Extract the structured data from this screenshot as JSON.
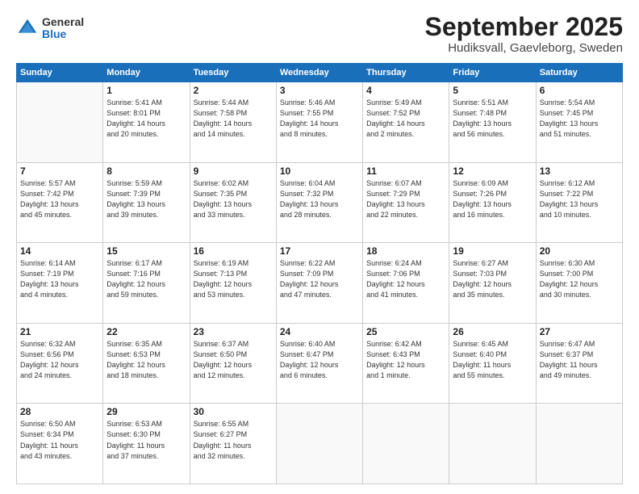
{
  "header": {
    "logo_general": "General",
    "logo_blue": "Blue",
    "month_title": "September 2025",
    "location": "Hudiksvall, Gaevleborg, Sweden"
  },
  "days_of_week": [
    "Sunday",
    "Monday",
    "Tuesday",
    "Wednesday",
    "Thursday",
    "Friday",
    "Saturday"
  ],
  "weeks": [
    [
      {
        "day": "",
        "text": ""
      },
      {
        "day": "1",
        "text": "Sunrise: 5:41 AM\nSunset: 8:01 PM\nDaylight: 14 hours\nand 20 minutes."
      },
      {
        "day": "2",
        "text": "Sunrise: 5:44 AM\nSunset: 7:58 PM\nDaylight: 14 hours\nand 14 minutes."
      },
      {
        "day": "3",
        "text": "Sunrise: 5:46 AM\nSunset: 7:55 PM\nDaylight: 14 hours\nand 8 minutes."
      },
      {
        "day": "4",
        "text": "Sunrise: 5:49 AM\nSunset: 7:52 PM\nDaylight: 14 hours\nand 2 minutes."
      },
      {
        "day": "5",
        "text": "Sunrise: 5:51 AM\nSunset: 7:48 PM\nDaylight: 13 hours\nand 56 minutes."
      },
      {
        "day": "6",
        "text": "Sunrise: 5:54 AM\nSunset: 7:45 PM\nDaylight: 13 hours\nand 51 minutes."
      }
    ],
    [
      {
        "day": "7",
        "text": "Sunrise: 5:57 AM\nSunset: 7:42 PM\nDaylight: 13 hours\nand 45 minutes."
      },
      {
        "day": "8",
        "text": "Sunrise: 5:59 AM\nSunset: 7:39 PM\nDaylight: 13 hours\nand 39 minutes."
      },
      {
        "day": "9",
        "text": "Sunrise: 6:02 AM\nSunset: 7:35 PM\nDaylight: 13 hours\nand 33 minutes."
      },
      {
        "day": "10",
        "text": "Sunrise: 6:04 AM\nSunset: 7:32 PM\nDaylight: 13 hours\nand 28 minutes."
      },
      {
        "day": "11",
        "text": "Sunrise: 6:07 AM\nSunset: 7:29 PM\nDaylight: 13 hours\nand 22 minutes."
      },
      {
        "day": "12",
        "text": "Sunrise: 6:09 AM\nSunset: 7:26 PM\nDaylight: 13 hours\nand 16 minutes."
      },
      {
        "day": "13",
        "text": "Sunrise: 6:12 AM\nSunset: 7:22 PM\nDaylight: 13 hours\nand 10 minutes."
      }
    ],
    [
      {
        "day": "14",
        "text": "Sunrise: 6:14 AM\nSunset: 7:19 PM\nDaylight: 13 hours\nand 4 minutes."
      },
      {
        "day": "15",
        "text": "Sunrise: 6:17 AM\nSunset: 7:16 PM\nDaylight: 12 hours\nand 59 minutes."
      },
      {
        "day": "16",
        "text": "Sunrise: 6:19 AM\nSunset: 7:13 PM\nDaylight: 12 hours\nand 53 minutes."
      },
      {
        "day": "17",
        "text": "Sunrise: 6:22 AM\nSunset: 7:09 PM\nDaylight: 12 hours\nand 47 minutes."
      },
      {
        "day": "18",
        "text": "Sunrise: 6:24 AM\nSunset: 7:06 PM\nDaylight: 12 hours\nand 41 minutes."
      },
      {
        "day": "19",
        "text": "Sunrise: 6:27 AM\nSunset: 7:03 PM\nDaylight: 12 hours\nand 35 minutes."
      },
      {
        "day": "20",
        "text": "Sunrise: 6:30 AM\nSunset: 7:00 PM\nDaylight: 12 hours\nand 30 minutes."
      }
    ],
    [
      {
        "day": "21",
        "text": "Sunrise: 6:32 AM\nSunset: 6:56 PM\nDaylight: 12 hours\nand 24 minutes."
      },
      {
        "day": "22",
        "text": "Sunrise: 6:35 AM\nSunset: 6:53 PM\nDaylight: 12 hours\nand 18 minutes."
      },
      {
        "day": "23",
        "text": "Sunrise: 6:37 AM\nSunset: 6:50 PM\nDaylight: 12 hours\nand 12 minutes."
      },
      {
        "day": "24",
        "text": "Sunrise: 6:40 AM\nSunset: 6:47 PM\nDaylight: 12 hours\nand 6 minutes."
      },
      {
        "day": "25",
        "text": "Sunrise: 6:42 AM\nSunset: 6:43 PM\nDaylight: 12 hours\nand 1 minute."
      },
      {
        "day": "26",
        "text": "Sunrise: 6:45 AM\nSunset: 6:40 PM\nDaylight: 11 hours\nand 55 minutes."
      },
      {
        "day": "27",
        "text": "Sunrise: 6:47 AM\nSunset: 6:37 PM\nDaylight: 11 hours\nand 49 minutes."
      }
    ],
    [
      {
        "day": "28",
        "text": "Sunrise: 6:50 AM\nSunset: 6:34 PM\nDaylight: 11 hours\nand 43 minutes."
      },
      {
        "day": "29",
        "text": "Sunrise: 6:53 AM\nSunset: 6:30 PM\nDaylight: 11 hours\nand 37 minutes."
      },
      {
        "day": "30",
        "text": "Sunrise: 6:55 AM\nSunset: 6:27 PM\nDaylight: 11 hours\nand 32 minutes."
      },
      {
        "day": "",
        "text": ""
      },
      {
        "day": "",
        "text": ""
      },
      {
        "day": "",
        "text": ""
      },
      {
        "day": "",
        "text": ""
      }
    ]
  ]
}
